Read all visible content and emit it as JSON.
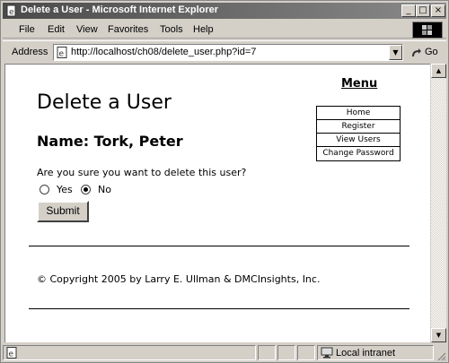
{
  "window": {
    "title": "Delete a User - Microsoft Internet Explorer",
    "controls": [
      "minimize-icon",
      "maximize-icon",
      "close-icon"
    ]
  },
  "menubar": {
    "items": [
      "File",
      "Edit",
      "View",
      "Favorites",
      "Tools",
      "Help"
    ]
  },
  "addressbar": {
    "label": "Address",
    "url": "http://localhost/ch08/delete_user.php?id=7",
    "go_label": "Go"
  },
  "page": {
    "heading": "Delete a User",
    "name_line": "Name: Tork, Peter",
    "question": "Are you sure you want to delete this user?",
    "options": [
      {
        "label": "Yes",
        "checked": false
      },
      {
        "label": "No",
        "checked": true
      }
    ],
    "submit_label": "Submit",
    "copyright": "© Copyright 2005 by Larry E. Ullman & DMCInsights, Inc.",
    "menu": {
      "heading": "Menu",
      "links": [
        "Home",
        "Register",
        "View Users",
        "Change Password"
      ]
    }
  },
  "statusbar": {
    "zone": "Local intranet"
  }
}
